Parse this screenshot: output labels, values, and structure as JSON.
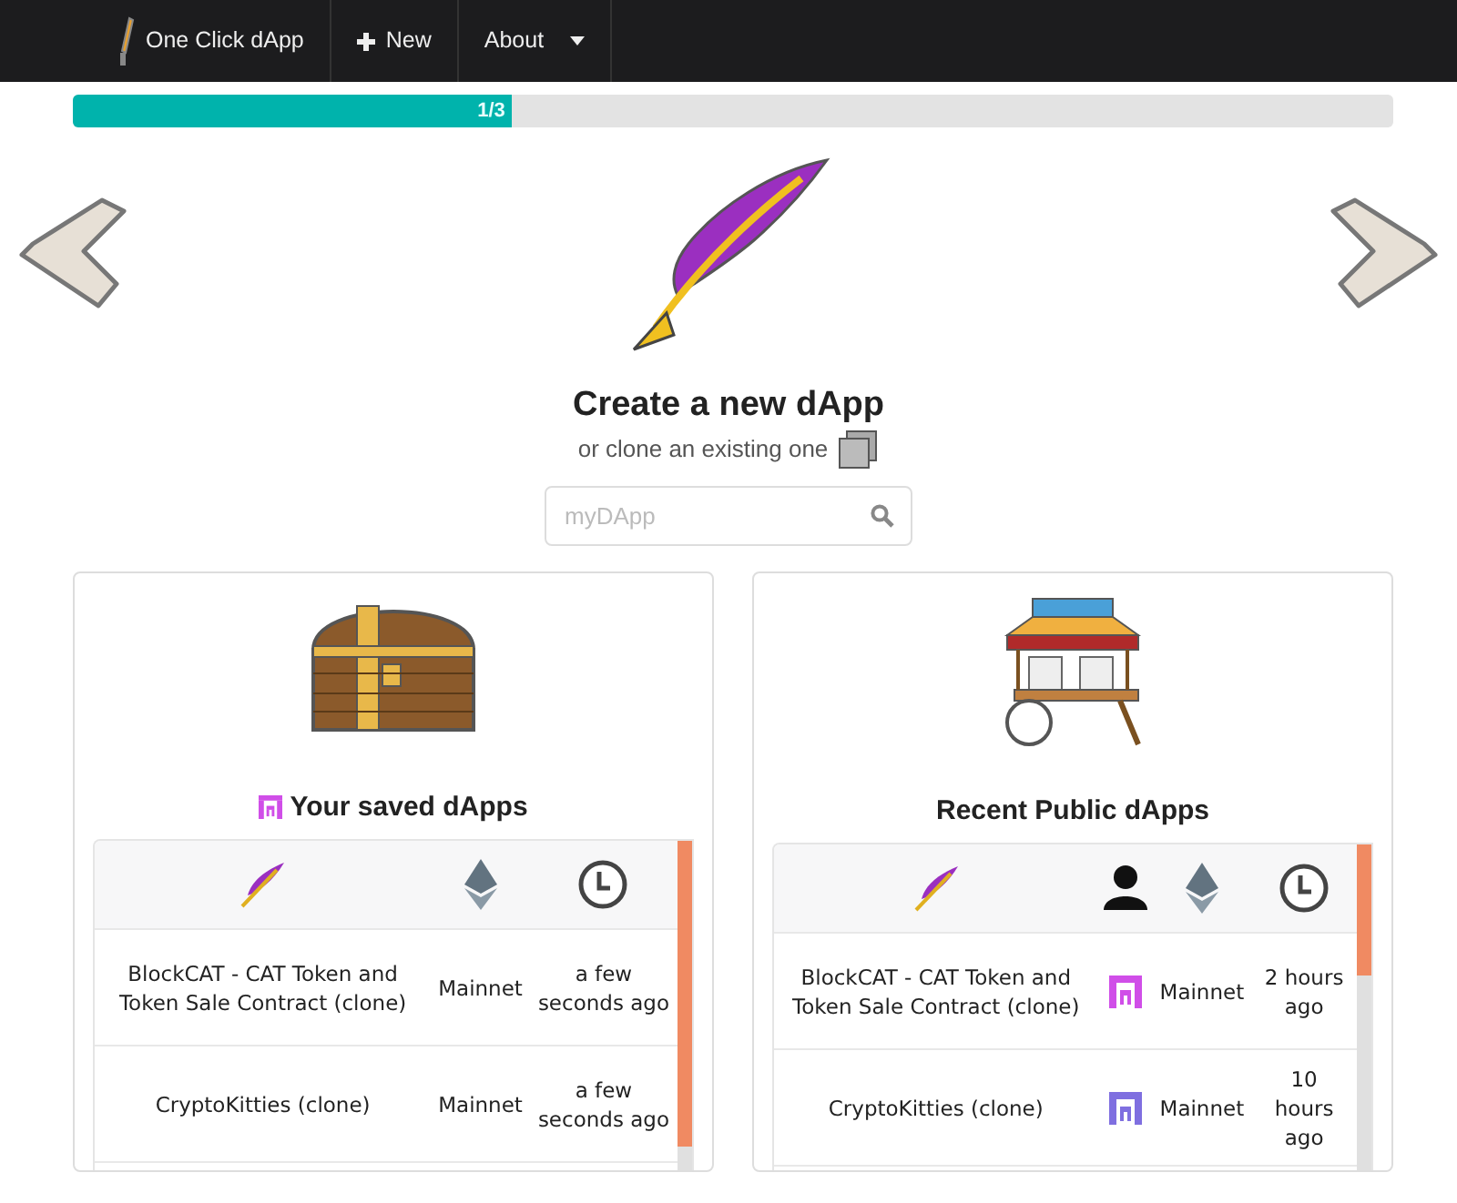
{
  "navbar": {
    "brand": "One Click dApp",
    "items": [
      {
        "label": "New",
        "kind": "new"
      },
      {
        "label": "About",
        "kind": "dropdown"
      }
    ]
  },
  "progress": {
    "level": 0.333,
    "label": "1/3"
  },
  "hero": {
    "title": "Create a new dApp",
    "subtitle": "or clone an existing one"
  },
  "search": {
    "placeholder": "myDApp"
  },
  "saved": {
    "title": "Your saved dApps",
    "avatar": {
      "color": "#d04ee8"
    },
    "rows": [
      {
        "name": "BlockCAT - CAT Token and Token Sale Contract (clone)",
        "network": "Mainnet",
        "time": "a few seconds ago"
      },
      {
        "name": "CryptoKitties (clone)",
        "network": "Mainnet",
        "time": "a few seconds ago"
      }
    ]
  },
  "public": {
    "title": "Recent Public dApps",
    "rows": [
      {
        "name": "BlockCAT - CAT Token and Token Sale Contract (clone)",
        "color": "#d04ee8",
        "network": "Mainnet",
        "time": "2 hours ago"
      },
      {
        "name": "CryptoKitties (clone)",
        "color": "#7f6fe0",
        "network": "Mainnet",
        "time": "10 hours ago"
      }
    ]
  }
}
